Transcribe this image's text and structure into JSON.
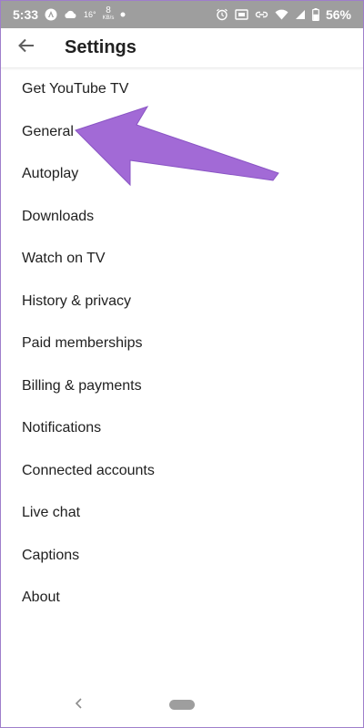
{
  "status_bar": {
    "time": "5:33",
    "temperature": "16°",
    "net_speed_value": "8",
    "net_speed_unit": "KB/s",
    "battery_percent": "56%",
    "icons": [
      "app-a-icon",
      "cloud-icon",
      "dot-icon",
      "alarm-icon",
      "cast-icon",
      "link-icon",
      "wifi-icon",
      "signal-icon",
      "battery-icon"
    ]
  },
  "app_bar": {
    "title": "Settings",
    "back_icon": "arrow-back-icon"
  },
  "menu": {
    "items": [
      {
        "label": "Get YouTube TV"
      },
      {
        "label": "General"
      },
      {
        "label": "Autoplay"
      },
      {
        "label": "Downloads"
      },
      {
        "label": "Watch on TV"
      },
      {
        "label": "History & privacy"
      },
      {
        "label": "Paid memberships"
      },
      {
        "label": "Billing & payments"
      },
      {
        "label": "Notifications"
      },
      {
        "label": "Connected accounts"
      },
      {
        "label": "Live chat"
      },
      {
        "label": "Captions"
      },
      {
        "label": "About"
      }
    ]
  },
  "annotation": {
    "arrow_color": "#a26ad6",
    "points_to": "General"
  },
  "nav_bar": {
    "icons": [
      "nav-back-icon",
      "home-pill-icon"
    ]
  },
  "colors": {
    "status_bar": "#9e9e9e",
    "text": "#212121",
    "frame": "#9f7ecb"
  }
}
